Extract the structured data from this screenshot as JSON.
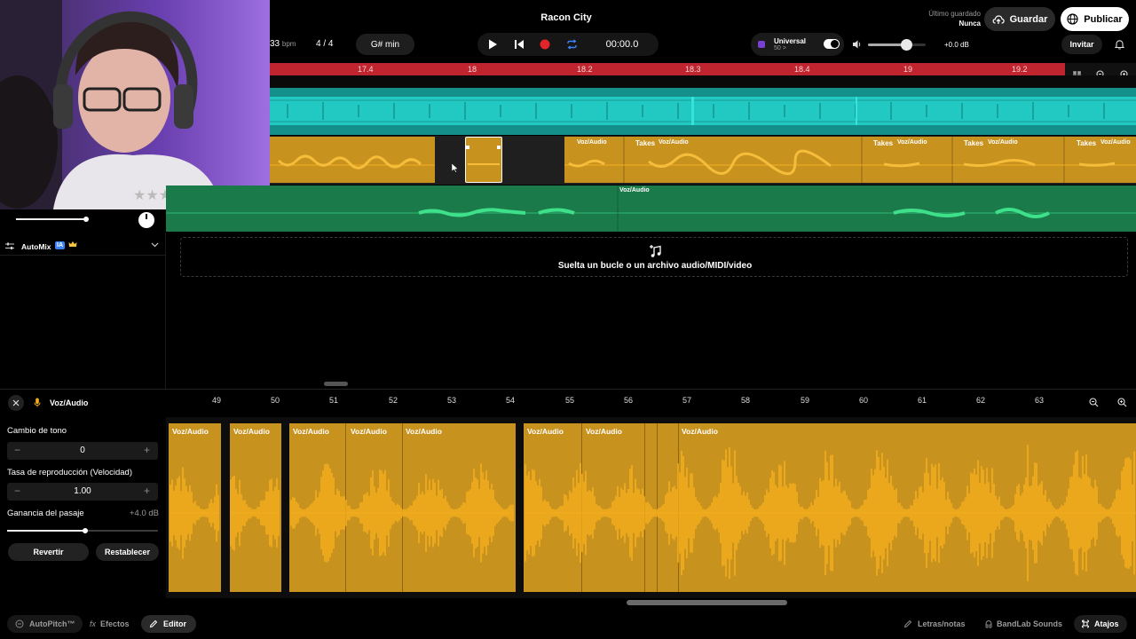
{
  "header": {
    "project_title": "Racon City",
    "last_saved_label": "Último guardado",
    "last_saved_value": "Nunca",
    "save_label": "Guardar",
    "publish_label": "Publicar",
    "invite_label": "Invitar"
  },
  "transport": {
    "bpm_value": "33",
    "bpm_unit": "bpm",
    "time_signature": "4 / 4",
    "key": "G# min",
    "time": "00:00.0",
    "tuner_name": "Universal",
    "tuner_value": "50 >",
    "volume_db": "+0.0 dB"
  },
  "ruler": {
    "ticks": [
      "17.4",
      "18",
      "18.2",
      "18.3",
      "18.4",
      "19",
      "19.2"
    ]
  },
  "tracks": {
    "clip_labels": [
      "Voz/Audio",
      "Takes",
      "Voz/Audio",
      "Takes",
      "Voz/Audio",
      "Takes",
      "Voz/Audio",
      "Takes",
      "Voz/Audio"
    ],
    "green_clip_label": "Voz/Audio",
    "automix_label": "AutoMix",
    "automix_badge": "IA",
    "drop_text": "Suelta un bucle o un archivo audio/MIDI/video"
  },
  "editor": {
    "track_name": "Voz/Audio",
    "pitch_label": "Cambio de tono",
    "pitch_value": "0",
    "rate_label": "Tasa de reproducción (Velocidad)",
    "rate_value": "1.00",
    "gain_label": "Ganancia del pasaje",
    "gain_value": "+4.0 dB",
    "revert_label": "Revertir",
    "reset_label": "Restablecer",
    "bar_numbers": [
      "49",
      "50",
      "51",
      "52",
      "53",
      "54",
      "55",
      "56",
      "57",
      "58",
      "59",
      "60",
      "61",
      "62",
      "63"
    ],
    "clip_labels": [
      "Voz/Audio",
      "Voz/Audio",
      "Voz/Audio",
      "Voz/Audio",
      "Voz/Audio",
      "Voz/Audio",
      "Voz/Audio",
      "Voz/Audio"
    ]
  },
  "bottom_bar": {
    "autopitch_label": "AutoPitch™",
    "effects_label": "Efectos",
    "editor_label": "Editor",
    "lyrics_label": "Letras/notas",
    "sounds_label": "BandLab Sounds",
    "shortcuts_label": "Atajos"
  },
  "colors": {
    "ruler_red": "#c0242f",
    "cyan_track": "#22c9c3",
    "orange_clip": "#c8921f",
    "orange_wave": "#f4ad1d",
    "green_track": "#23a466",
    "green_wave": "#3fe08a",
    "record_red": "#e3242b",
    "accent_blue": "#3b82f6"
  },
  "icons": [
    "play-icon",
    "skip-back-icon",
    "record-icon",
    "loop-icon",
    "cloud-upload-icon",
    "globe-icon",
    "bell-icon",
    "speaker-icon",
    "magnet-icon",
    "zoom-out-icon",
    "zoom-in-icon",
    "music-note-plus-icon",
    "close-icon",
    "mic-icon",
    "minus-icon",
    "plus-icon",
    "crown-icon",
    "chevron-down-icon",
    "effects-icon",
    "pencil-icon",
    "notes-icon",
    "sounds-icon",
    "shortcuts-icon"
  ]
}
